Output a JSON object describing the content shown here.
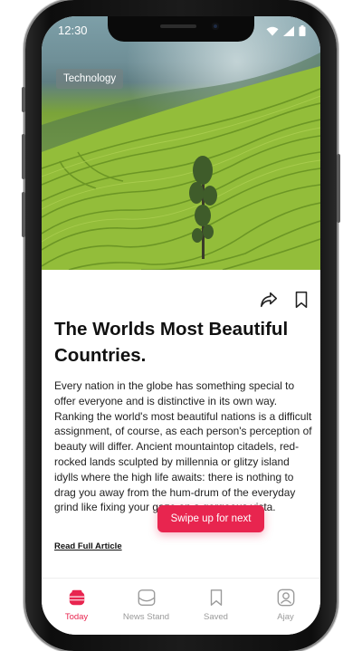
{
  "status_bar": {
    "time": "12:30"
  },
  "hero": {
    "tag": "Technology"
  },
  "article": {
    "title": "The Worlds Most Beautiful Countries.",
    "body": "Every nation in the globe has something special to offer everyone and is distinctive in its own way. Ranking the world's most beautiful nations is a difficult assignment, of course, as each person's perception of beauty will differ. Ancient mountaintop citadels, red-rocked lands sculpted by millennia or glitzy island idylls where the high life awaits: there is nothing to drag you away from the hum-drum of the everyday grind like fixing your gaze on a gorgeous vista.",
    "read_link": "Read Full Article"
  },
  "swipe_button": {
    "label": "Swipe up for next"
  },
  "tabs": [
    {
      "label": "Today",
      "icon": "today-icon",
      "active": true
    },
    {
      "label": "News Stand",
      "icon": "newsstand-icon",
      "active": false
    },
    {
      "label": "Saved",
      "icon": "bookmark-icon",
      "active": false
    },
    {
      "label": "Ajay",
      "icon": "profile-icon",
      "active": false
    }
  ],
  "colors": {
    "accent": "#e8254f",
    "inactive": "#9a9a9a"
  }
}
